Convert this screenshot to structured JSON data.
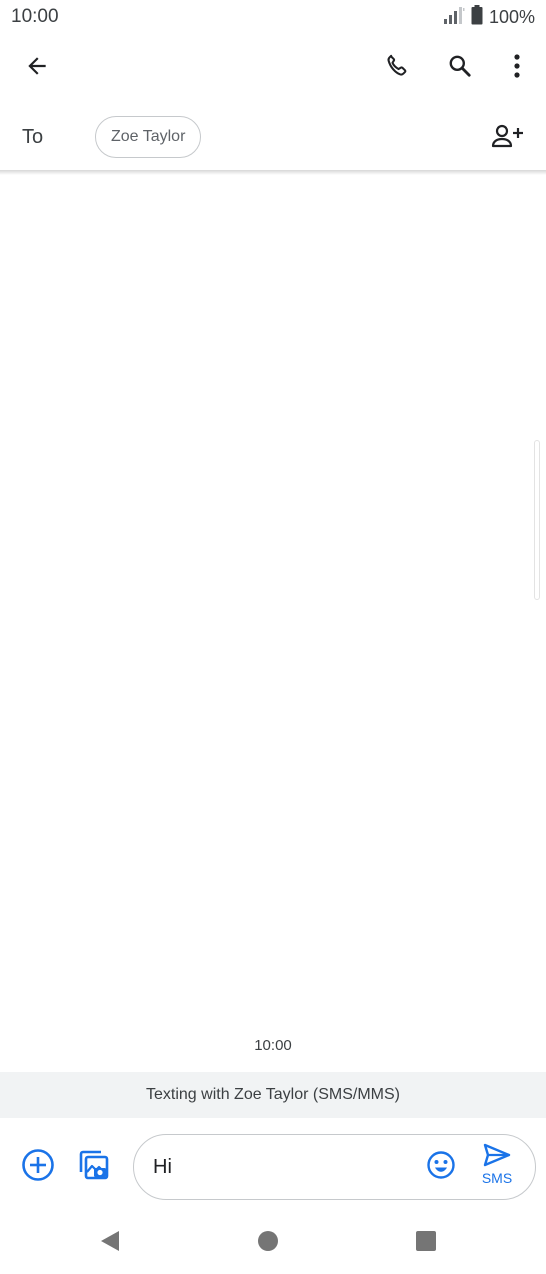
{
  "status_bar": {
    "time": "10:00",
    "battery": "100%",
    "icons": [
      "signal-icon",
      "battery-icon"
    ]
  },
  "app_bar": {
    "icons": [
      "back-arrow-icon",
      "phone-icon",
      "search-icon",
      "more-vert-icon"
    ]
  },
  "recipient": {
    "to_label": "To",
    "chip": "Zoe Taylor",
    "add_icon": "add-person-icon"
  },
  "conversation": {
    "timestamp": "10:00",
    "info": "Texting with Zoe Taylor (SMS/MMS)"
  },
  "compose": {
    "text": "Hi",
    "send_label": "SMS",
    "icons": [
      "add-circle-icon",
      "gallery-icon",
      "emoji-icon",
      "send-icon"
    ]
  },
  "nav_bar": {
    "icons": [
      "nav-back-icon",
      "nav-home-icon",
      "nav-recents-icon"
    ]
  },
  "colors": {
    "accent": "#1a73e8",
    "icon_dark": "#3c4043",
    "strip_bg": "#f1f3f4",
    "nav_icon": "#757575"
  }
}
